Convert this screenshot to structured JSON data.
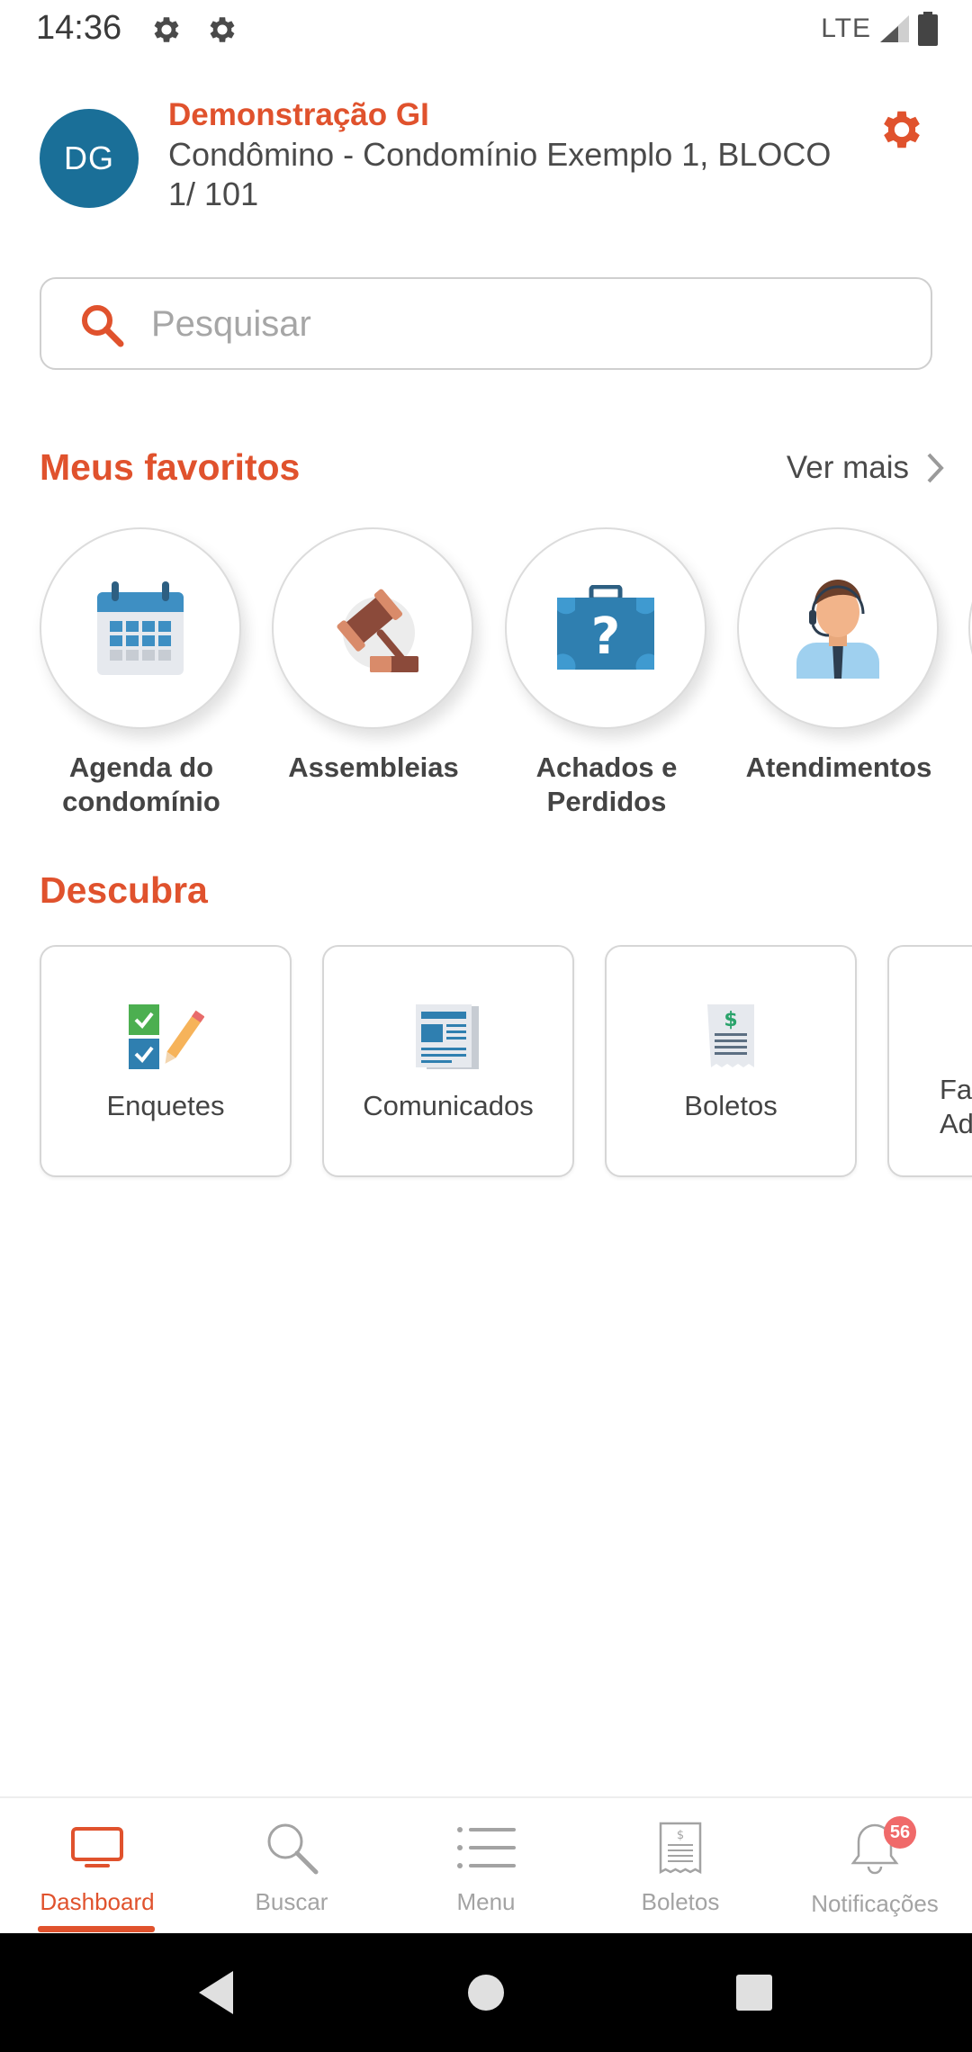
{
  "status_bar": {
    "time": "14:36",
    "network": "LTE",
    "icons": [
      "gear-icon",
      "gear-icon",
      "signal-icon",
      "battery-icon"
    ]
  },
  "header": {
    "avatar_initials": "DG",
    "user_name": "Demonstração GI",
    "user_role_location": "Condômino - Condomínio Exemplo 1, BLOCO 1/ 101",
    "avatar_color": "#1a6f98",
    "accent_color": "#e0522d"
  },
  "search": {
    "placeholder": "Pesquisar",
    "value": ""
  },
  "favorites": {
    "title": "Meus favoritos",
    "see_more": "Ver mais",
    "items": [
      {
        "label": "Agenda do condomínio",
        "icon": "calendar-icon"
      },
      {
        "label": "Assembleias",
        "icon": "gavel-icon"
      },
      {
        "label": "Achados e Perdidos",
        "icon": "lost-found-suitcase-icon"
      },
      {
        "label": "Atendimentos",
        "icon": "support-agent-icon"
      }
    ]
  },
  "discover": {
    "title": "Descubra",
    "items": [
      {
        "label": "Enquetes",
        "icon": "poll-checklist-icon"
      },
      {
        "label": "Comunicados",
        "icon": "newspaper-icon"
      },
      {
        "label": "Boletos",
        "icon": "bill-receipt-icon"
      },
      {
        "label": "Fa\nAdm",
        "icon": ""
      }
    ]
  },
  "bottom_nav": {
    "items": [
      {
        "label": "Dashboard",
        "icon": "monitor-icon",
        "active": true
      },
      {
        "label": "Buscar",
        "icon": "search-icon",
        "active": false
      },
      {
        "label": "Menu",
        "icon": "menu-list-icon",
        "active": false
      },
      {
        "label": "Boletos",
        "icon": "receipt-icon",
        "active": false
      },
      {
        "label": "Notificações",
        "icon": "bell-icon",
        "active": false,
        "badge": "56"
      }
    ]
  },
  "system_nav": {
    "icons": [
      "back-icon",
      "home-icon",
      "recents-icon"
    ]
  }
}
